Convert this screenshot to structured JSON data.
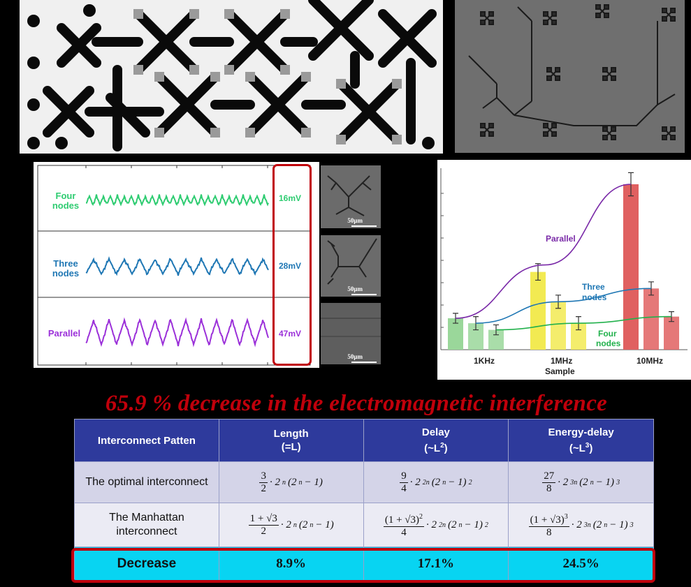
{
  "waveforms": {
    "rows": [
      {
        "label_line1": "Four",
        "label_line2": "nodes",
        "amplitude": "16mV",
        "color": "#2ecc71"
      },
      {
        "label_line1": "Three",
        "label_line2": "nodes",
        "amplitude": "28mV",
        "color": "#1f77b4"
      },
      {
        "label_line1": "Parallel",
        "label_line2": "",
        "amplitude": "47mV",
        "color": "#9b30d9"
      }
    ]
  },
  "thumbnails": {
    "scale_label": "50μm"
  },
  "chart_data": {
    "type": "bar",
    "categories": [
      "1KHz",
      "1MHz",
      "10MHz"
    ],
    "xlabel": "Sample",
    "series": [
      {
        "name": "Parallel",
        "color": "#e8a2a2",
        "values": [
          19,
          47,
          100
        ],
        "errors": [
          3,
          5,
          7
        ]
      },
      {
        "name": "Three nodes",
        "color": "#f0e87a",
        "values": [
          16,
          29,
          37
        ],
        "errors": [
          4,
          4,
          4
        ]
      },
      {
        "name": "Four nodes",
        "color": "#8fd48f",
        "values": [
          12,
          16,
          20
        ],
        "errors": [
          3,
          4,
          3
        ]
      }
    ],
    "bar_colors_by_category": [
      "#9ad79a",
      "#f2ea52",
      "#e06060"
    ],
    "curve_labels": [
      "Parallel",
      "Three nodes",
      "Four nodes"
    ],
    "curve_colors": [
      "#7a2aa8",
      "#1f77b4",
      "#22b14c"
    ]
  },
  "headline": "65.9 % decrease in the electromagnetic interference",
  "table": {
    "headers": {
      "c0": "Interconnect Patten",
      "c1_line1": "Length",
      "c1_line2": "(=L)",
      "c2_line1": "Delay",
      "c2_line2": "(~L",
      "c2_sup": "2",
      "c2_close": ")",
      "c3_line1": "Energy-delay",
      "c3_line2": "(~L",
      "c3_sup": "3",
      "c3_close": ")"
    },
    "rows": {
      "optimal_label": "The optimal interconnect",
      "manhattan_label": "The Manhattan interconnect",
      "decrease_label": "Decrease"
    },
    "decrease": {
      "length": "8.9%",
      "delay": "17.1%",
      "energy_delay": "24.5%"
    }
  },
  "colors": {
    "accent_red": "#c0000b",
    "header_blue": "#2e3a9c",
    "highlight_cyan": "#08d4f2"
  }
}
